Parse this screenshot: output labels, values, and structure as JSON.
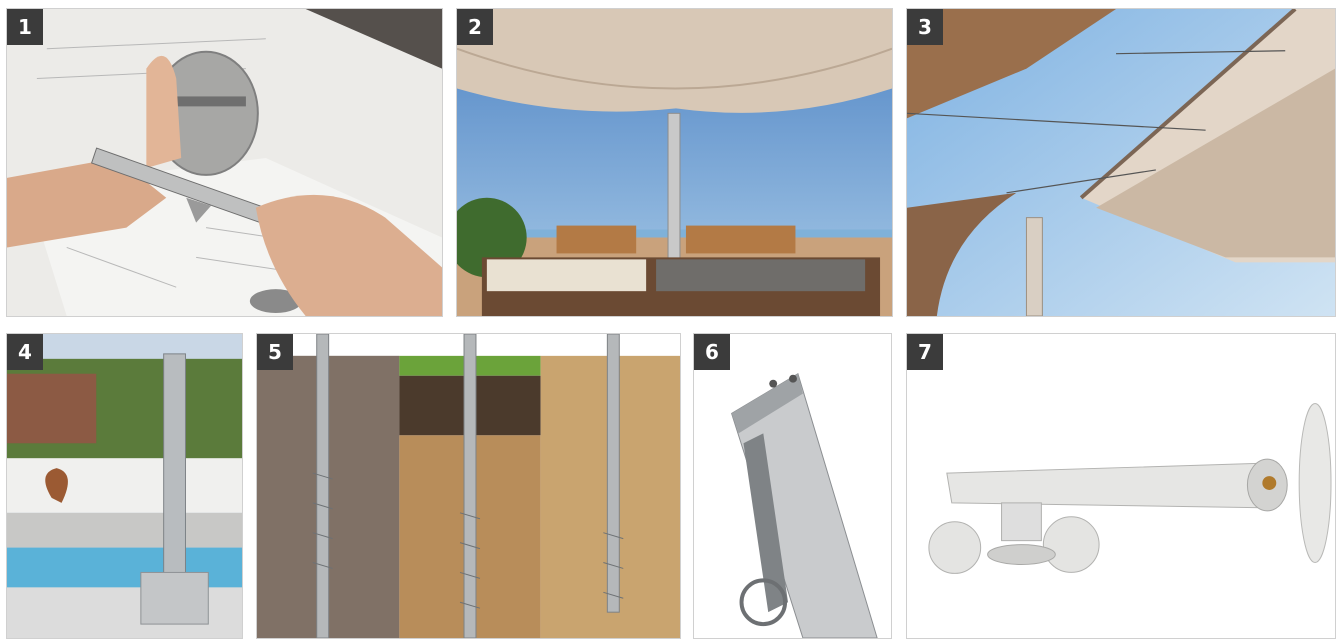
{
  "panels": [
    {
      "number": "1"
    },
    {
      "number": "2"
    },
    {
      "number": "3"
    },
    {
      "number": "4"
    },
    {
      "number": "5"
    },
    {
      "number": "6"
    },
    {
      "number": "7"
    }
  ]
}
